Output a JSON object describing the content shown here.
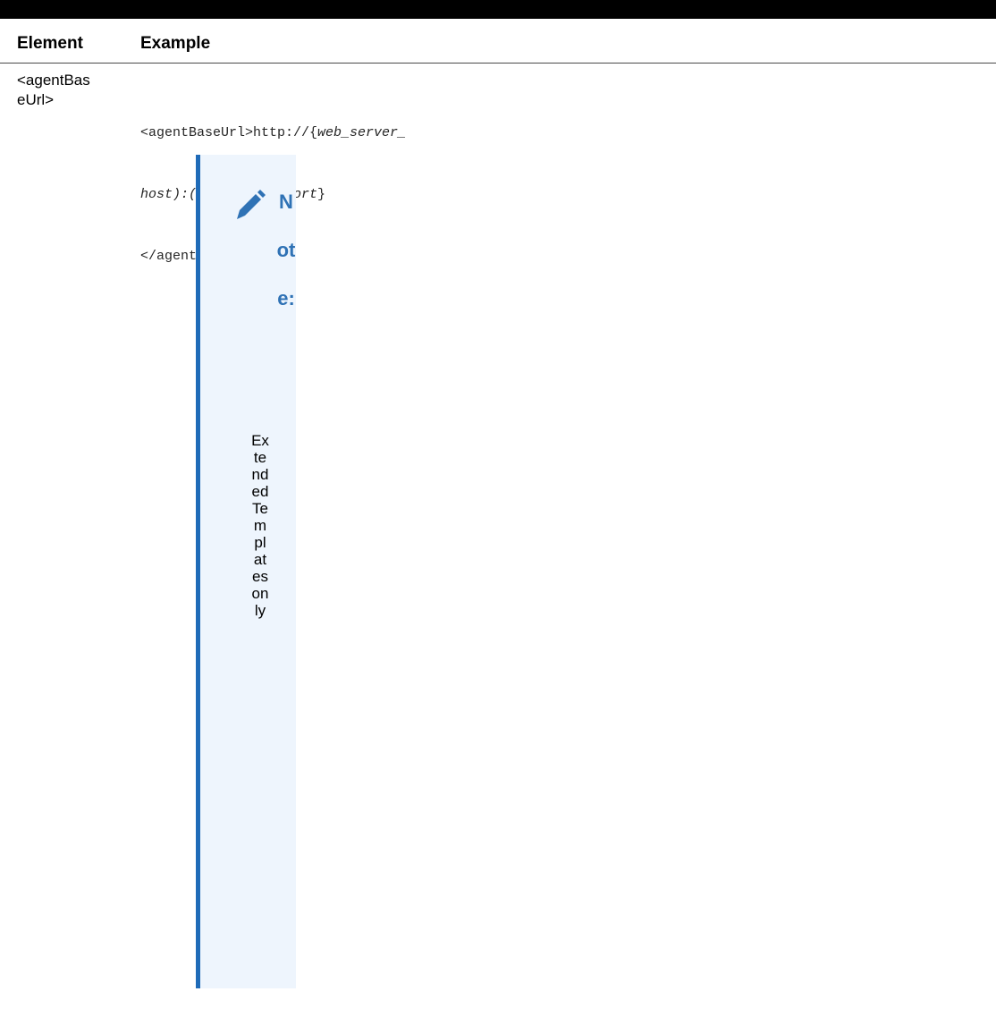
{
  "table": {
    "columns": [
      "Element",
      "Example"
    ],
    "rows": [
      {
        "element_line1": "<agentBas",
        "element_line2": "eUrl>",
        "example": {
          "line1_prefix": "<agentBaseUrl>http://{",
          "line1_italic": "web_server_",
          "line2_italic": "host):(web_server_port",
          "line2_suffix": "}",
          "line3": "</agentBaseUrl>"
        },
        "note": {
          "icon": "pencil-icon",
          "label": "Note:",
          "text": "ExtendedTemplates only"
        }
      }
    ]
  },
  "colors": {
    "note_bar": "#1f6bb8",
    "note_background": "#eef5fd",
    "note_label": "#2f72b5"
  }
}
